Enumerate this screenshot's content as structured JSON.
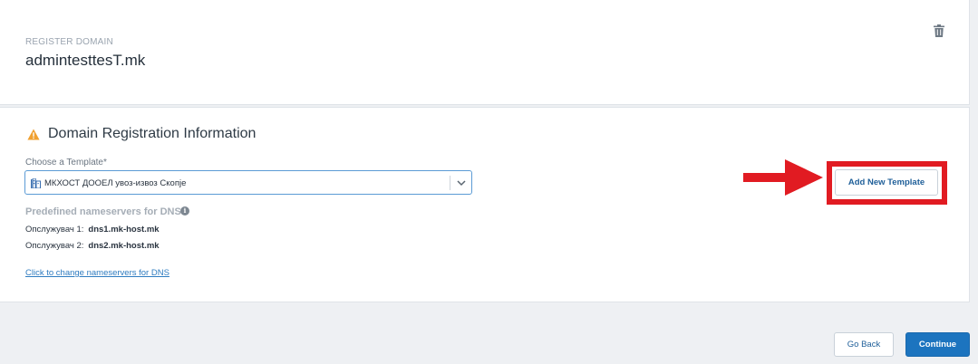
{
  "domain_card": {
    "label": "REGISTER DOMAIN",
    "domain_name": "admintesttesT.mk",
    "delete_icon": "trash-icon"
  },
  "registration": {
    "title": "Domain Registration Information",
    "warning_icon": "warning-triangle-icon",
    "warning_color": "#f0a030",
    "template_label": "Choose a Template*",
    "template_selected": "МКХОСТ ДООЕЛ увоз-извоз Скопје",
    "template_icon": "building-icon",
    "nameservers_heading": "Predefined nameservers for DNS",
    "nameservers": [
      {
        "label": "Опслужувач 1:",
        "value": "dns1.mk-host.mk"
      },
      {
        "label": "Опслужувач 2:",
        "value": "dns2.mk-host.mk"
      }
    ],
    "change_link": "Click to change nameservers for DNS",
    "add_template_button": "Add New Template",
    "highlight_color": "#e11b22"
  },
  "footer": {
    "back_button": "Go Back",
    "continue_button": "Continue"
  }
}
